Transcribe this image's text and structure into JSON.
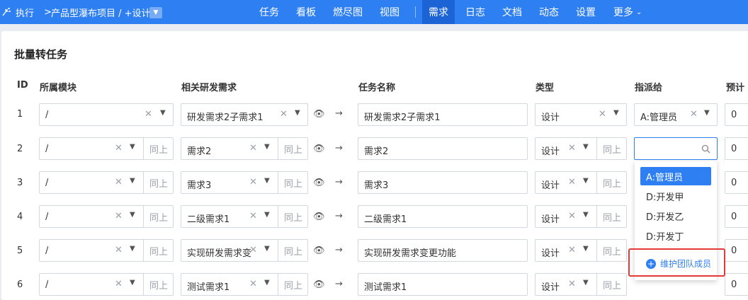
{
  "header": {
    "exec_label": "执行",
    "separator": ">",
    "project": "产品型瀑布项目 / +设计",
    "nav": [
      {
        "label": "任务"
      },
      {
        "label": "看板"
      },
      {
        "label": "燃尽图"
      },
      {
        "label": "视图"
      },
      {
        "label": "需求",
        "active": true
      },
      {
        "label": "日志"
      },
      {
        "label": "文档"
      },
      {
        "label": "动态"
      },
      {
        "label": "设置"
      },
      {
        "label": "更多"
      }
    ]
  },
  "page": {
    "title": "批量转任务",
    "columns": {
      "id": "ID",
      "module": "所属模块",
      "story": "相关研发需求",
      "task_name": "任务名称",
      "type": "类型",
      "assign": "指派给",
      "estimate": "预计"
    },
    "same_label": "同上",
    "rows": [
      {
        "id": "1",
        "module": "/",
        "story": "研发需求2子需求1",
        "task_name": "研发需求2子需求1",
        "type": "设计",
        "assign": "A:管理员",
        "estimate": "0"
      },
      {
        "id": "2",
        "module": "/",
        "story": "需求2",
        "task_name": "需求2",
        "type": "设计",
        "assign": "",
        "estimate": "0"
      },
      {
        "id": "3",
        "module": "/",
        "story": "需求3",
        "task_name": "需求3",
        "type": "设计",
        "assign": "",
        "estimate": "0"
      },
      {
        "id": "4",
        "module": "/",
        "story": "二级需求1",
        "task_name": "二级需求1",
        "type": "设计",
        "assign": "",
        "estimate": "0"
      },
      {
        "id": "5",
        "module": "/",
        "story": "实现研发需求变更功能",
        "task_name": "实现研发需求变更功能",
        "type": "设计",
        "assign": "",
        "estimate": "0"
      },
      {
        "id": "6",
        "module": "/",
        "story": "测试需求1",
        "task_name": "测试需求1",
        "type": "设计",
        "assign": "",
        "estimate": "0"
      }
    ]
  },
  "assign_dropdown": {
    "options": [
      "A:管理员",
      "D:开发甲",
      "D:开发乙",
      "D:开发丁"
    ],
    "selected": "A:管理员",
    "maintain_label": "维护团队成员"
  }
}
